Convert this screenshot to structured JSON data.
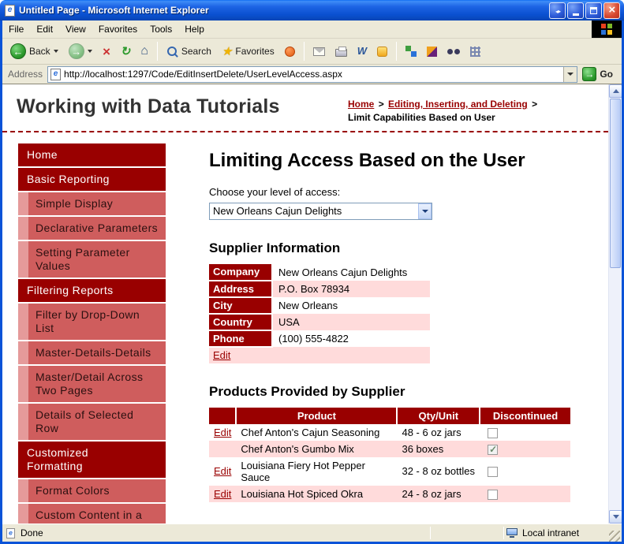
{
  "window": {
    "title": "Untitled Page - Microsoft Internet Explorer",
    "status": {
      "left": "Done",
      "zone": "Local intranet"
    }
  },
  "menu": {
    "items": [
      "File",
      "Edit",
      "View",
      "Favorites",
      "Tools",
      "Help"
    ]
  },
  "toolbar": {
    "back_label": "Back",
    "search_label": "Search",
    "favorites_label": "Favorites"
  },
  "address_bar": {
    "label": "Address",
    "url": "http://localhost:1297/Code/EditInsertDelete/UserLevelAccess.aspx",
    "go_label": "Go"
  },
  "icons": {
    "back": "green-circle-left-arrow",
    "forward": "green-circle-right-arrow",
    "stop": "red-x",
    "refresh": "circular-arrow",
    "home": "house",
    "search": "magnifier",
    "favorites": "star",
    "media": "orange-circle",
    "mail": "envelope",
    "print": "printer",
    "edit_with_word": "word-w",
    "go": "green-right-arrow",
    "page": "ie-document-e",
    "zone": "computer-monitor",
    "windows_logo": "four-color-flag"
  },
  "page": {
    "site_title": "Working with Data Tutorials",
    "breadcrumb": {
      "home": "Home",
      "separator": ">",
      "section": "Editing, Inserting, and Deleting",
      "current": "Limit Capabilities Based on User"
    },
    "sidebar": {
      "items": [
        {
          "label": "Home",
          "level": 0
        },
        {
          "label": "Basic Reporting",
          "level": 0
        },
        {
          "label": "Simple Display",
          "level": 1
        },
        {
          "label": "Declarative Parameters",
          "level": 1
        },
        {
          "label": "Setting Parameter Values",
          "level": 1
        },
        {
          "label": "Filtering Reports",
          "level": 0
        },
        {
          "label": "Filter by Drop-Down List",
          "level": 1
        },
        {
          "label": "Master-Details-Details",
          "level": 1
        },
        {
          "label": "Master/Detail Across Two Pages",
          "level": 1
        },
        {
          "label": "Details of Selected Row",
          "level": 1
        },
        {
          "label": "Customized Formatting",
          "level": 0
        },
        {
          "label": "Format Colors",
          "level": 1
        },
        {
          "label": "Custom Content in a",
          "level": 1
        }
      ]
    },
    "main": {
      "heading": "Limiting Access Based on the User",
      "access_label": "Choose your level of access:",
      "access_selected": "New Orleans Cajun Delights",
      "supplier": {
        "heading": "Supplier Information",
        "rows": [
          {
            "label": "Company",
            "value": "New Orleans Cajun Delights"
          },
          {
            "label": "Address",
            "value": "P.O. Box 78934"
          },
          {
            "label": "City",
            "value": "New Orleans"
          },
          {
            "label": "Country",
            "value": "USA"
          },
          {
            "label": "Phone",
            "value": "(100) 555-4822"
          }
        ],
        "edit_label": "Edit"
      },
      "products": {
        "heading": "Products Provided by Supplier",
        "headers": {
          "product": "Product",
          "qty": "Qty/Unit",
          "discontinued": "Discontinued"
        },
        "rows": [
          {
            "edit": "Edit",
            "product": "Chef Anton's Cajun Seasoning",
            "qty": "48 - 6 oz jars",
            "discontinued": false
          },
          {
            "edit": "",
            "product": "Chef Anton's Gumbo Mix",
            "qty": "36 boxes",
            "discontinued": true
          },
          {
            "edit": "Edit",
            "product": "Louisiana Fiery Hot Pepper Sauce",
            "qty": "32 - 8 oz bottles",
            "discontinued": false
          },
          {
            "edit": "Edit",
            "product": "Louisiana Hot Spiced Okra",
            "qty": "24 - 8 oz jars",
            "discontinued": false
          }
        ]
      }
    }
  },
  "colors": {
    "maroon": "#990000",
    "sidebar_subitem": "#cf5d5d",
    "row_pink": "#ffdbdb",
    "titlebar_blue": "#0a53d8",
    "chrome_tan": "#ece9d8"
  }
}
